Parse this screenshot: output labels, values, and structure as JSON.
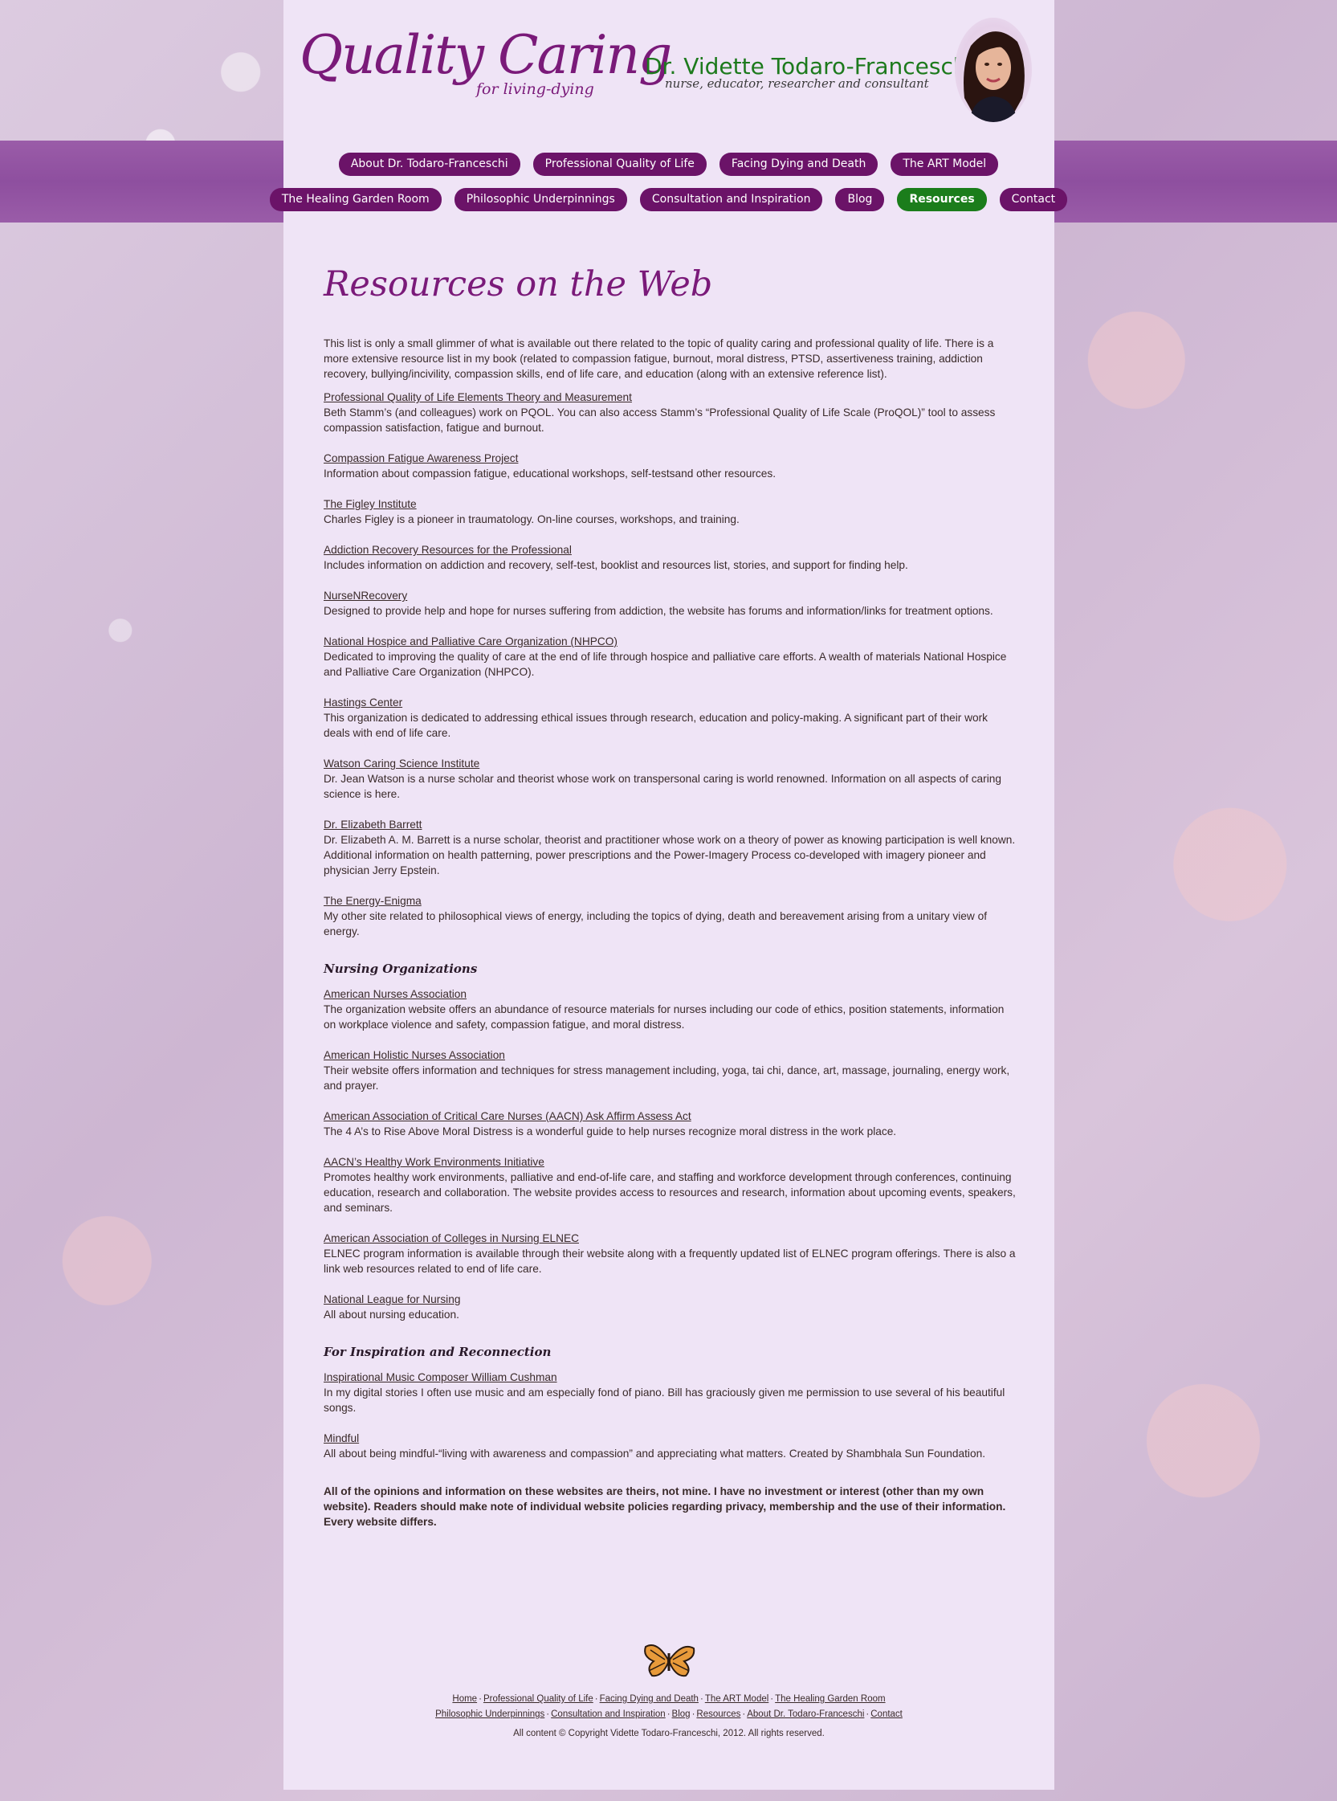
{
  "header": {
    "logo_title": "Quality Caring",
    "logo_tagline": "for living-dying",
    "doctor_name": "Dr. Vidette Todaro-Franceschi",
    "doctor_title": "nurse, educator, researcher and consultant"
  },
  "nav": {
    "row1": [
      "About Dr. Todaro-Franceschi",
      "Professional Quality of Life",
      "Facing Dying and Death",
      "The ART Model"
    ],
    "row2": [
      "The Healing Garden Room",
      "Philosophic Underpinnings",
      "Consultation and Inspiration",
      "Blog",
      "Resources",
      "Contact"
    ],
    "active": "Resources",
    "active_color": "#1b7d1b",
    "button_color": "#6b1368"
  },
  "page": {
    "title": "Resources on the Web",
    "intro": "This list is only a small glimmer of what is available out there related to the topic of quality caring and professional quality of life. There is a more extensive resource list in my book (related to compassion fatigue, burnout, moral distress, PTSD, assertiveness training, addiction recovery, bullying/incivility, compassion skills, end of life care, and education (along with an extensive reference list)."
  },
  "resources": [
    {
      "link": "Professional Quality of Life Elements Theory and Measurement",
      "desc": "Beth Stamm’s (and colleagues) work on PQOL. You can also access Stamm’s “Professional Quality of Life Scale (ProQOL)” tool to assess compassion satisfaction, fatigue and burnout."
    },
    {
      "link": "Compassion Fatigue Awareness Project",
      "desc": "Information about compassion fatigue, educational workshops, self-testsand other resources."
    },
    {
      "link": "The Figley Institute",
      "desc": "Charles Figley is a pioneer in traumatology. On-line courses, workshops, and training."
    },
    {
      "link": "Addiction Recovery Resources for the Professional",
      "desc": "Includes information on addiction and recovery, self-test, booklist and resources list, stories, and support for finding help."
    },
    {
      "link": "NurseNRecovery",
      "desc": "Designed to provide help and hope for nurses suffering from addiction, the website has forums and information/links for treatment options."
    },
    {
      "link": "National Hospice and Palliative Care Organization (NHPCO)",
      "desc": "Dedicated to improving the quality of care at the end of life through hospice and palliative care efforts. A wealth of materials National Hospice and Palliative Care Organization (NHPCO)."
    },
    {
      "link": "Hastings Center",
      "desc": "This organization is dedicated to addressing ethical issues through research, education and policy-making. A significant part of their work deals with end of life care."
    },
    {
      "link": "Watson Caring Science Institute",
      "desc": "Dr. Jean Watson is a nurse scholar and theorist whose work on transpersonal caring is world renowned. Information on all aspects of caring science is here."
    },
    {
      "link": "Dr. Elizabeth Barrett",
      "desc": "Dr. Elizabeth A. M. Barrett is a nurse scholar, theorist and practitioner whose work on a theory of power as knowing participation is well known. Additional information on health patterning, power prescriptions and the Power-Imagery Process co-developed with imagery pioneer and physician Jerry Epstein."
    },
    {
      "link": "The Energy-Enigma",
      "desc": "My other site related to philosophical views of energy, including the topics of dying, death and bereavement arising from a unitary view of energy."
    }
  ],
  "nursing": {
    "title": "Nursing Organizations",
    "items": [
      {
        "link": "American Nurses Association",
        "desc": "The organization website offers an abundance of resource materials for nurses including our code of ethics, position statements, information on workplace violence and safety, compassion fatigue, and moral distress."
      },
      {
        "link": "American Holistic Nurses Association",
        "desc": "Their website offers information and techniques for stress management including, yoga, tai chi, dance, art, massage, journaling, energy work, and prayer."
      },
      {
        "link": "American Association of Critical Care Nurses (AACN) Ask Affirm Assess Act",
        "desc": "The 4 A’s to Rise Above Moral Distress is a wonderful guide to help nurses recognize moral distress in the work place."
      },
      {
        "link": "AACN’s Healthy Work Environments Initiative",
        "desc": "Promotes healthy work environments, palliative and end-of-life care, and staffing and workforce development through conferences, continuing education, research and collaboration. The website provides access to resources and research, information about upcoming events, speakers, and seminars."
      },
      {
        "link": "American Association of Colleges in Nursing ELNEC",
        "desc": "ELNEC program information is available through their website along with a frequently updated list of ELNEC program offerings. There is also a link web resources related to end of life care."
      },
      {
        "link": "National League for Nursing",
        "desc": "All about nursing education."
      }
    ]
  },
  "inspiration": {
    "title": "For Inspiration and Reconnection",
    "items": [
      {
        "link": "Inspirational Music Composer William Cushman",
        "desc": "In my digital stories I often use music and am especially fond of piano. Bill has graciously given me permission to use several of his beautiful songs."
      },
      {
        "link": "Mindful",
        "desc": "All about being mindful-“living with awareness and compassion” and appreciating what matters. Created by Shambhala Sun Foundation."
      }
    ]
  },
  "disclaimer": "All of the opinions and information on these websites are theirs, not mine. I have no investment or interest (other than my own website). Readers should make note of individual website policies regarding privacy, membership and the use of their information. Every website differs.",
  "footer": {
    "row1": [
      "Home",
      "Professional Quality of Life",
      "Facing Dying and Death",
      "The ART Model",
      "The Healing Garden Room"
    ],
    "row2": [
      "Philosophic Underpinnings",
      "Consultation and Inspiration",
      "Blog",
      "Resources",
      "About Dr. Todaro-Franceschi",
      "Contact"
    ],
    "separator": "·",
    "copyright": "All content © Copyright Vidette Todaro-Franceschi, 2012. All rights reserved."
  }
}
